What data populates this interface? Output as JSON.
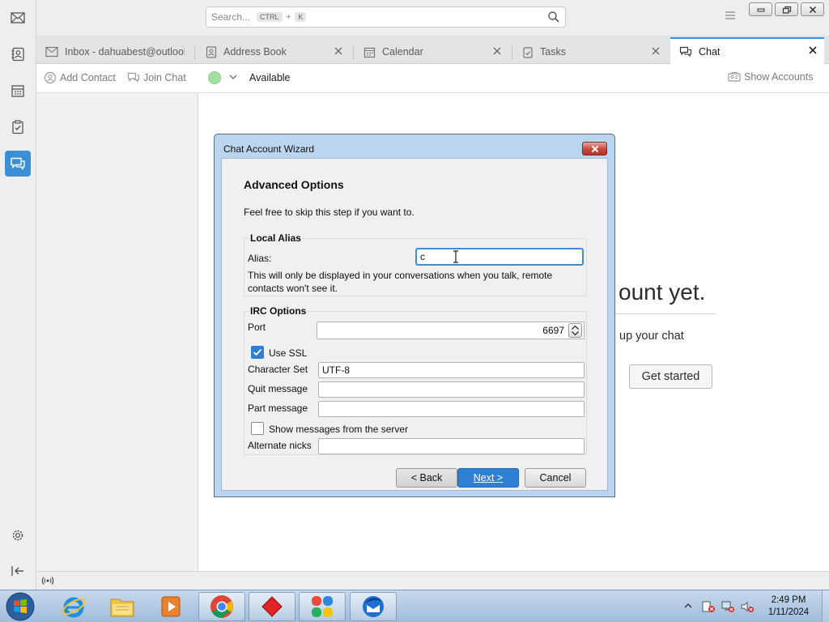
{
  "spaces": {
    "items": [
      {
        "name": "mail-icon"
      },
      {
        "name": "address-book-icon"
      },
      {
        "name": "calendar-icon"
      },
      {
        "name": "tasks-icon"
      },
      {
        "name": "chat-icon"
      }
    ],
    "settings": "gear-icon",
    "collapse": "collapse-left-icon"
  },
  "search": {
    "placeholder": "Search...",
    "shortcut_mod": "CTRL",
    "shortcut_sep": "+",
    "shortcut_key": "K"
  },
  "tabs": [
    {
      "label": "Inbox - dahuabest@outlook.com",
      "icon": "mail-icon"
    },
    {
      "label": "Address Book",
      "icon": "address-book-icon"
    },
    {
      "label": "Calendar",
      "icon": "calendar-icon"
    },
    {
      "label": "Tasks",
      "icon": "tasks-icon"
    },
    {
      "label": "Chat",
      "icon": "chat-icon",
      "selected": true
    }
  ],
  "chat_toolbar": {
    "add_contact": "Add Contact",
    "join_chat": "Join Chat",
    "status": "Available",
    "show_accounts": "Show Accounts"
  },
  "background": {
    "heading": "ount yet.",
    "subtitle": "up your chat",
    "get_started": "Get started"
  },
  "dialog": {
    "title": "Chat Account Wizard",
    "heading": "Advanced Options",
    "description": "Feel free to skip this step if you want to.",
    "local_alias": {
      "group_title": "Local Alias",
      "alias_label": "Alias:",
      "alias_value": "c",
      "note": "This will only be displayed in your conversations when you talk, remote contacts won't see it."
    },
    "irc": {
      "group_title": "IRC Options",
      "port_label": "Port",
      "port_value": "6697",
      "use_ssl_label": "Use SSL",
      "use_ssl_checked": true,
      "charset_label": "Character Set",
      "charset_value": "UTF-8",
      "quit_label": "Quit message",
      "quit_value": "",
      "part_label": "Part message",
      "part_value": "",
      "server_msgs_label": "Show messages from the server",
      "server_msgs_checked": false,
      "alt_nicks_label": "Alternate nicks",
      "alt_nicks_value": ""
    },
    "buttons": {
      "back": "< Back",
      "next": "Next >",
      "cancel": "Cancel"
    }
  },
  "taskbar": {
    "time": "2:49 PM",
    "date": "1/11/2024"
  },
  "colors": {
    "accent": "#3b8fd6",
    "status_available": "#a4e0a0",
    "primary_button": "#2f7fd4"
  }
}
